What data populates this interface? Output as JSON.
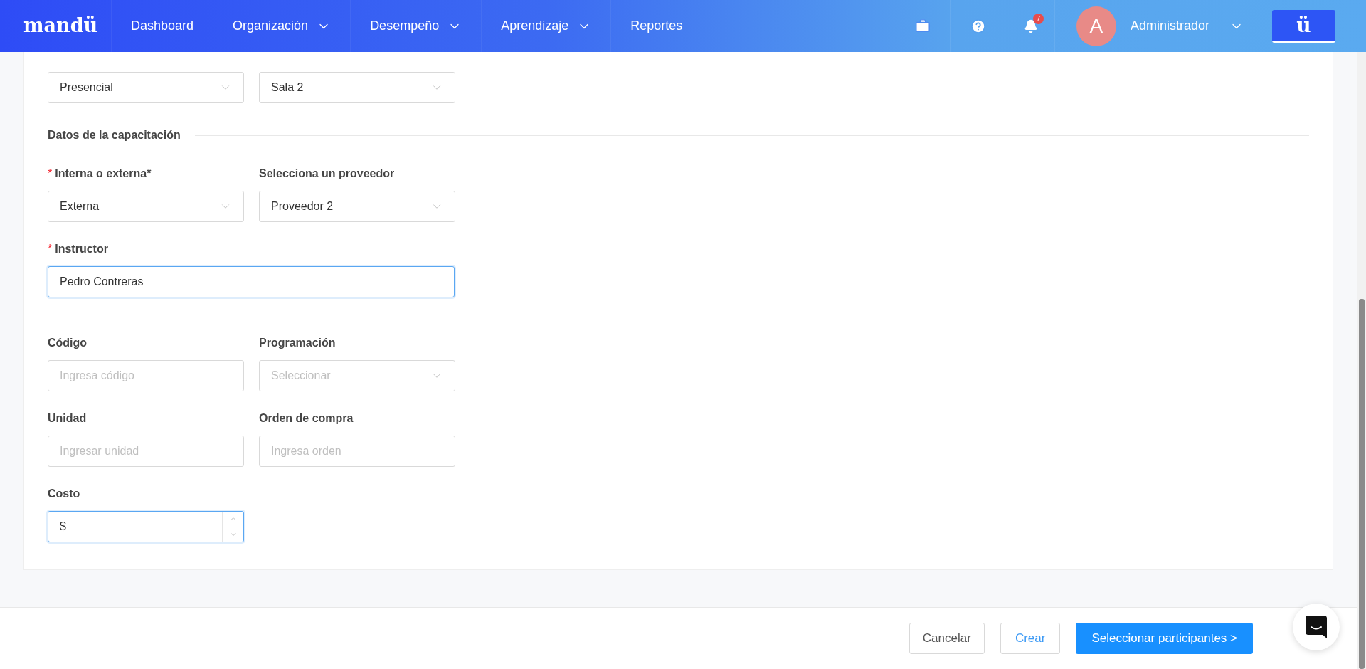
{
  "nav": {
    "logo": "mandü",
    "items": [
      {
        "label": "Dashboard",
        "dropdown": false
      },
      {
        "label": "Organización",
        "dropdown": true
      },
      {
        "label": "Desempeño",
        "dropdown": true
      },
      {
        "label": "Aprendizaje",
        "dropdown": true
      },
      {
        "label": "Reportes",
        "dropdown": false
      }
    ],
    "notifications": "7",
    "user": {
      "avatar": "A",
      "name": "Administrador"
    },
    "brand_button": "ü"
  },
  "form": {
    "top_fields": [
      {
        "kind": "select",
        "value": "Presencial"
      },
      {
        "kind": "select",
        "value": "Sala 2"
      }
    ],
    "section_title": "Datos de la capacitación",
    "rows": [
      [
        {
          "kind": "select",
          "required_mark": "*",
          "label": "Interna o externa*",
          "value": "Externa",
          "focused": false
        },
        {
          "kind": "select",
          "label": "Selecciona un proveedor",
          "value": "Proveedor 2",
          "focused": false
        }
      ],
      [
        {
          "kind": "text",
          "wide": true,
          "required_mark": "*",
          "label": "Instructor",
          "value": "Pedro Contreras",
          "focused": true
        }
      ],
      [
        {
          "kind": "text",
          "label": "Código",
          "placeholder": "Ingresa código",
          "focused": false
        },
        {
          "kind": "select",
          "label": "Programación",
          "placeholder": "Seleccionar",
          "focused": false
        }
      ],
      [
        {
          "kind": "text",
          "label": "Unidad",
          "placeholder": "Ingresar unidad",
          "focused": false
        },
        {
          "kind": "text",
          "label": "Orden de compra",
          "placeholder": "Ingresa orden",
          "focused": false
        }
      ],
      [
        {
          "kind": "number",
          "label": "Costo",
          "value": "$",
          "focused": true
        }
      ]
    ]
  },
  "footer": {
    "buttons": [
      {
        "kind": "default",
        "label": "Cancelar"
      },
      {
        "kind": "outline",
        "label": "Crear"
      },
      {
        "kind": "primary",
        "label": "Seleccionar participantes >"
      }
    ]
  }
}
